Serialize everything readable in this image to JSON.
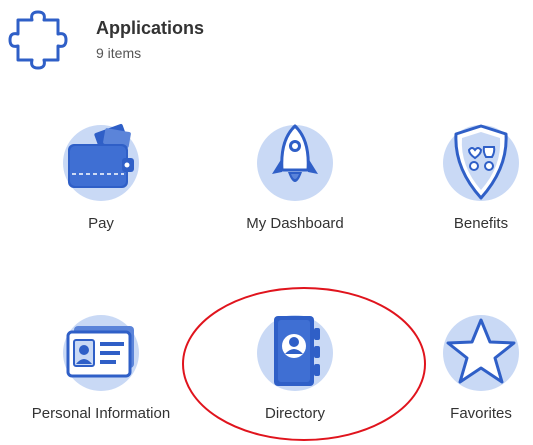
{
  "header": {
    "title": "Applications",
    "count": "9 items",
    "icon": "puzzle-icon"
  },
  "apps": [
    {
      "label": "Pay",
      "icon": "wallet-icon"
    },
    {
      "label": "My Dashboard",
      "icon": "rocket-icon"
    },
    {
      "label": "Benefits",
      "icon": "shield-icon"
    },
    {
      "label": "Personal Information",
      "icon": "id-card-icon"
    },
    {
      "label": "Directory",
      "icon": "address-book-icon"
    },
    {
      "label": "Favorites",
      "icon": "star-icon"
    }
  ],
  "colors": {
    "icon_primary": "#2f5fc7",
    "icon_light": "#c9d9f5",
    "annotation": "#e0141d"
  }
}
